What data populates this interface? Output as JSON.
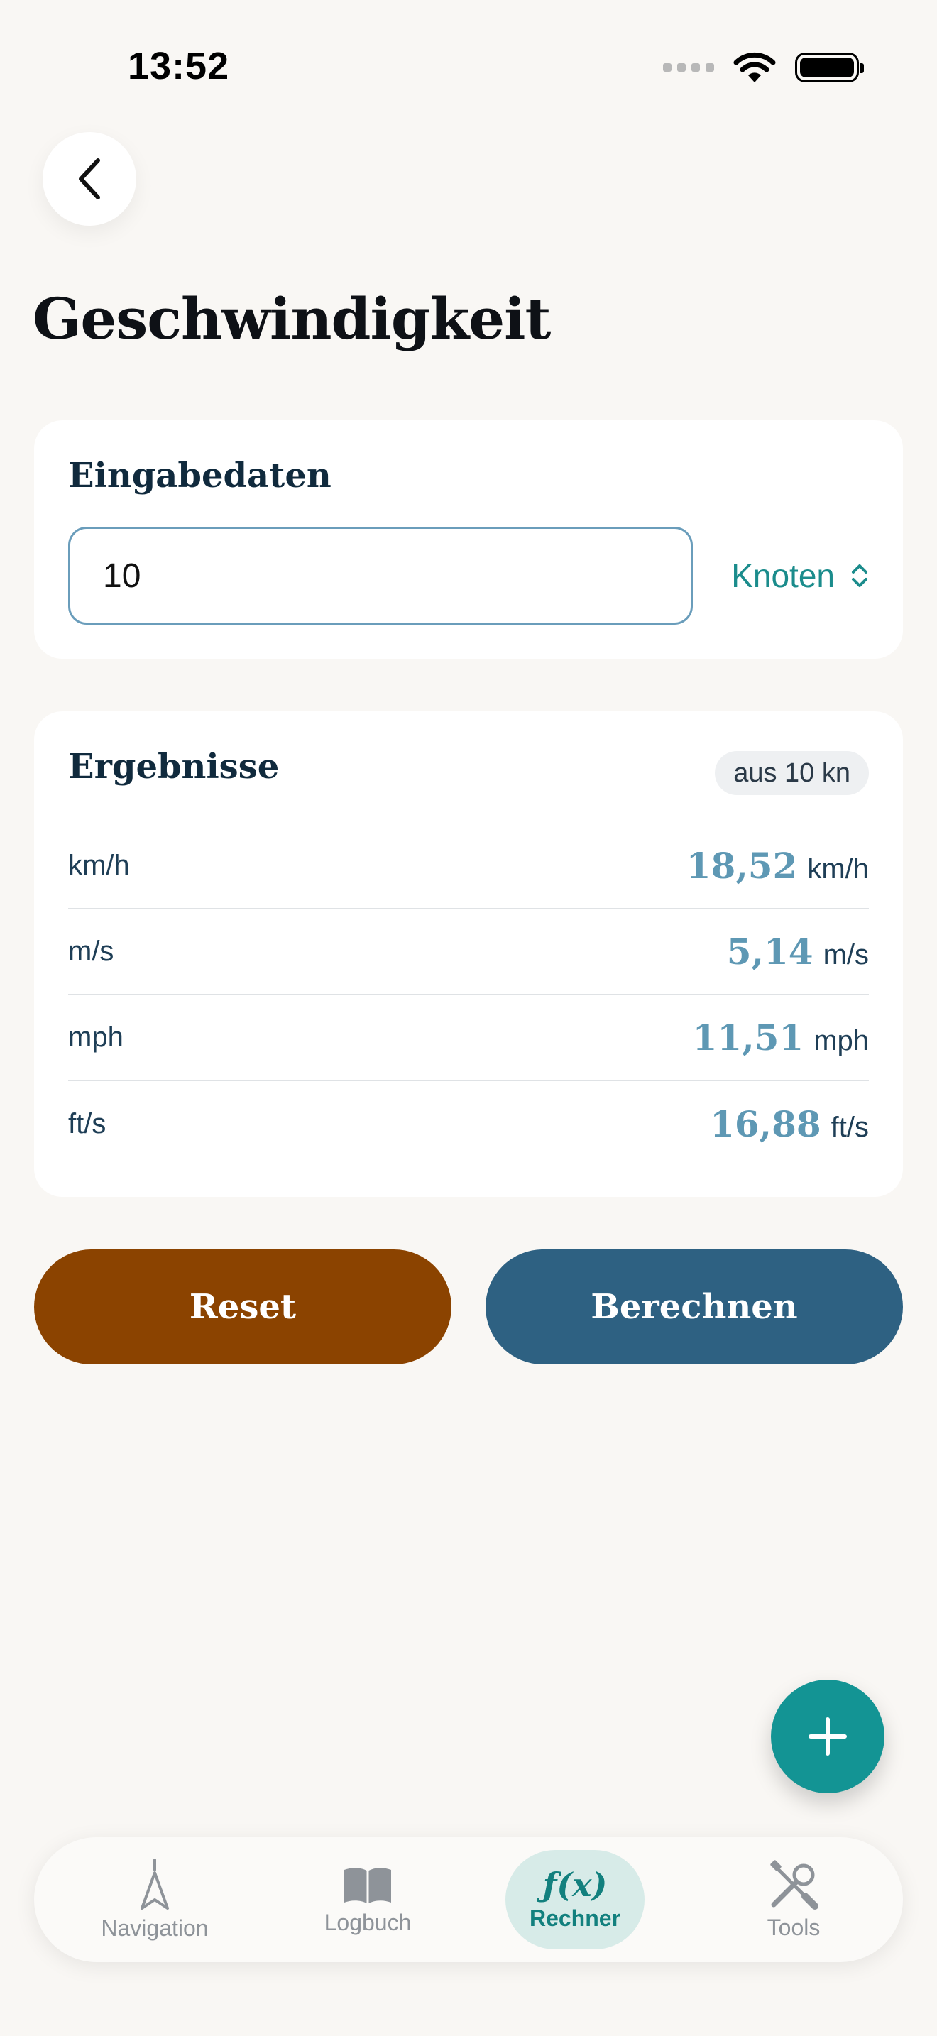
{
  "status_bar": {
    "time": "13:52"
  },
  "header": {
    "title": "Geschwindigkeit"
  },
  "input_card": {
    "heading": "Eingabedaten",
    "value": "10",
    "unit": "Knoten"
  },
  "results_card": {
    "heading": "Ergebnisse",
    "badge": "aus 10 kn",
    "rows": [
      {
        "label": "km/h",
        "value": "18,52",
        "unit": "km/h"
      },
      {
        "label": "m/s",
        "value": "5,14",
        "unit": "m/s"
      },
      {
        "label": "mph",
        "value": "11,51",
        "unit": "mph"
      },
      {
        "label": "ft/s",
        "value": "16,88",
        "unit": "ft/s"
      }
    ]
  },
  "actions": {
    "reset": "Reset",
    "calculate": "Berechnen"
  },
  "tabbar": {
    "items": [
      {
        "label": "Navigation",
        "icon": "compass-arrow-icon",
        "active": false
      },
      {
        "label": "Logbuch",
        "icon": "book-icon",
        "active": false
      },
      {
        "label": "Rechner",
        "icon": "function-icon",
        "icon_text": "ƒ(x)",
        "active": true
      },
      {
        "label": "Tools",
        "icon": "tools-icon",
        "active": false
      }
    ]
  },
  "colors": {
    "background": "#f9f7f4",
    "accent_teal": "#139494",
    "reset": "#8b4300",
    "calculate": "#2e6182",
    "result_value": "#5e98b4"
  }
}
